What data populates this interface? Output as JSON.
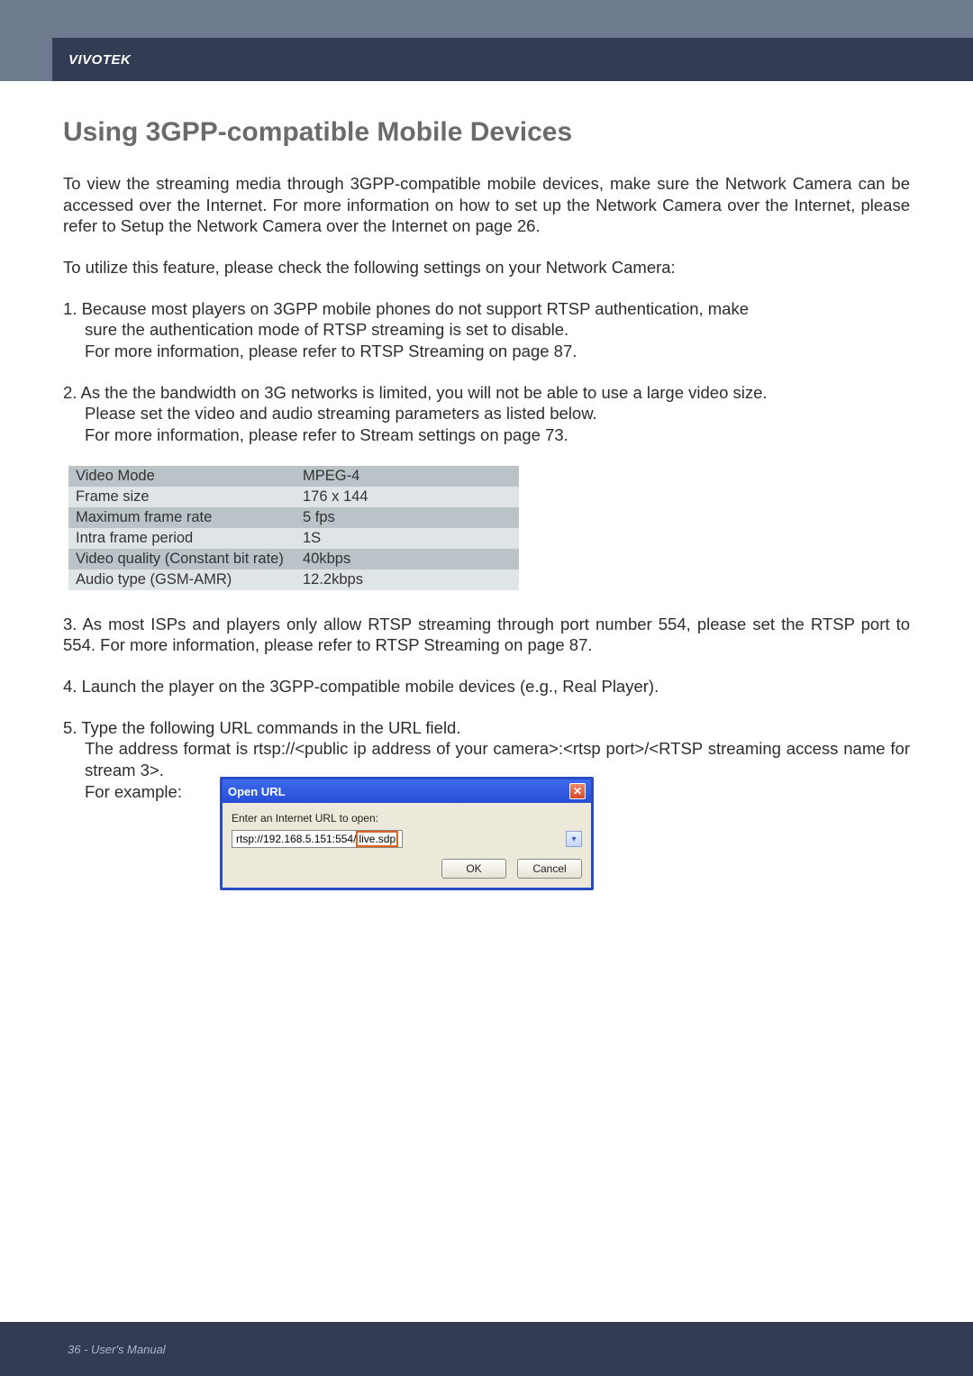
{
  "brand": "VIVOTEK",
  "heading": "Using 3GPP-compatible Mobile Devices",
  "para1": "To view the streaming media through 3GPP-compatible mobile devices, make sure the Network Camera can be accessed over the Internet. For more information on how to set up the Network Camera over the Internet, please refer to Setup the Network Camera over the Internet on page 26.",
  "para2": "To utilize this feature, please check the following settings on your Network Camera:",
  "item1_l1": "1. Because most players on 3GPP mobile phones do not support RTSP authentication, make",
  "item1_l2": "sure the authentication mode of RTSP streaming is set to disable.",
  "item1_l3": "For more information, please refer to RTSP Streaming on page 87.",
  "item2_l1": "2. As the the bandwidth on 3G networks is limited, you will not be able to use a large video size.",
  "item2_l2": "Please set the video and audio streaming parameters as listed below.",
  "item2_l3": "For more information, please refer to Stream settings on page 73.",
  "table": {
    "rows": [
      {
        "k": "Video Mode",
        "v": "MPEG-4"
      },
      {
        "k": "Frame size",
        "v": "176 x 144"
      },
      {
        "k": "Maximum frame rate",
        "v": "5 fps"
      },
      {
        "k": "Intra frame period",
        "v": "1S"
      },
      {
        "k": "Video quality (Constant bit rate)",
        "v": "40kbps"
      },
      {
        "k": "Audio type (GSM-AMR)",
        "v": "12.2kbps"
      }
    ]
  },
  "item3": "3. As most ISPs and players only allow RTSP streaming through port number 554, please set the RTSP port to 554. For more information, please refer to RTSP Streaming on page 87.",
  "item4": "4. Launch the player on the 3GPP-compatible mobile devices (e.g., Real Player).",
  "item5_l1": "5. Type the following URL commands in the URL field.",
  "item5_l2": "The address format is rtsp://<public ip address of your camera>:<rtsp port>/<RTSP streaming access name for stream 3>.",
  "item5_l3": "For example:",
  "dialog": {
    "title": "Open URL",
    "label": "Enter an Internet URL to open:",
    "url_pre": "rtsp://192.168.5.151:554/",
    "url_hl": "live.sdp",
    "ok": "OK",
    "cancel": "Cancel",
    "combo_glyph": "▾",
    "close_glyph": "✕"
  },
  "footer": "36 - User's Manual"
}
